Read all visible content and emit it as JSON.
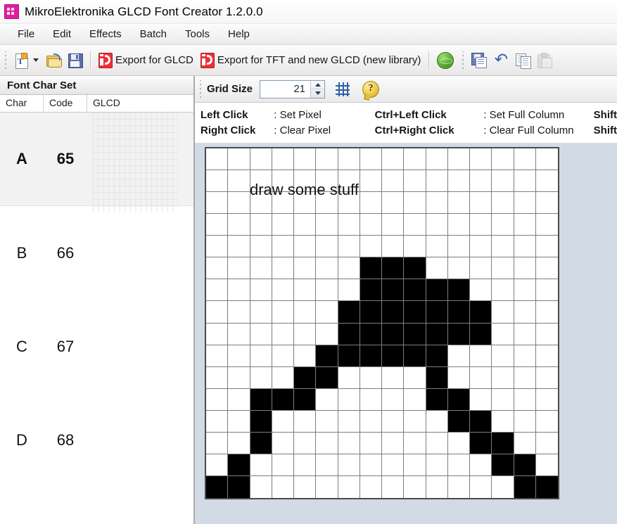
{
  "window": {
    "title": "MikroElektronika GLCD Font Creator 1.2.0.0",
    "app_icon": "app-icon"
  },
  "menubar": {
    "items": [
      {
        "label": "File"
      },
      {
        "label": "Edit"
      },
      {
        "label": "Effects"
      },
      {
        "label": "Batch"
      },
      {
        "label": "Tools"
      },
      {
        "label": "Help"
      }
    ]
  },
  "toolbar": {
    "new_font_label": "",
    "open_label": "",
    "save_label": "",
    "export_glcd_label": "Export for GLCD",
    "export_tft_label": "Export for TFT and new GLCD (new library)",
    "icons": {
      "new_font": "new-font-icon",
      "dropdown": "chevron-down-icon",
      "open": "open-folder-icon",
      "save": "save-icon",
      "export_glcd": "export-glcd-icon",
      "export_tft": "export-tft-icon",
      "web": "globe-icon",
      "save_as": "save-as-icon",
      "undo": "undo-icon",
      "copy": "copy-icon",
      "paste": "paste-icon"
    },
    "undo_glyph": "↶"
  },
  "grid_toolbar": {
    "grid_size_label": "Grid Size",
    "grid_size_value": "21",
    "grid_tool_icon": "grid-icon",
    "help_icon": "help-icon",
    "help_glyph": "?"
  },
  "left_panel": {
    "header": "Font Char Set",
    "columns": [
      "Char",
      "Code",
      "GLCD"
    ],
    "rows": [
      {
        "char": "A",
        "code": "65",
        "selected": true
      },
      {
        "char": "B",
        "code": "66",
        "selected": false
      },
      {
        "char": "C",
        "code": "67",
        "selected": false
      },
      {
        "char": "D",
        "code": "68",
        "selected": false
      }
    ]
  },
  "legend": {
    "line1": [
      {
        "key": "Left Click",
        "value": ": Set Pixel"
      },
      {
        "key": "Ctrl+Left Click",
        "value": ": Set Full Column"
      },
      {
        "key": "Shift",
        "value": ""
      }
    ],
    "line2": [
      {
        "key": "Right Click",
        "value": ": Clear Pixel"
      },
      {
        "key": "Ctrl+Right Click",
        "value": ": Clear Full Column"
      },
      {
        "key": "Shift",
        "value": ""
      }
    ]
  },
  "canvas": {
    "annotation": "draw some stuff",
    "grid_cols": 16,
    "grid_rows": 16,
    "on_color": "#000000",
    "off_color": "#ffffff",
    "line_color": "#7d7d7d",
    "filled_cells": [
      [
        5,
        7
      ],
      [
        5,
        8
      ],
      [
        5,
        9
      ],
      [
        6,
        7
      ],
      [
        6,
        8
      ],
      [
        6,
        9
      ],
      [
        6,
        10
      ],
      [
        6,
        11
      ],
      [
        7,
        6
      ],
      [
        7,
        7
      ],
      [
        7,
        8
      ],
      [
        7,
        9
      ],
      [
        7,
        10
      ],
      [
        7,
        11
      ],
      [
        7,
        12
      ],
      [
        8,
        6
      ],
      [
        8,
        7
      ],
      [
        8,
        8
      ],
      [
        8,
        9
      ],
      [
        8,
        10
      ],
      [
        8,
        11
      ],
      [
        8,
        12
      ],
      [
        9,
        5
      ],
      [
        9,
        6
      ],
      [
        9,
        7
      ],
      [
        9,
        8
      ],
      [
        9,
        9
      ],
      [
        9,
        10
      ],
      [
        10,
        4
      ],
      [
        10,
        5
      ],
      [
        10,
        10
      ],
      [
        11,
        2
      ],
      [
        11,
        3
      ],
      [
        11,
        4
      ],
      [
        11,
        10
      ],
      [
        11,
        11
      ],
      [
        12,
        2
      ],
      [
        12,
        11
      ],
      [
        12,
        12
      ],
      [
        13,
        2
      ],
      [
        13,
        12
      ],
      [
        13,
        13
      ],
      [
        14,
        1
      ],
      [
        14,
        13
      ],
      [
        14,
        14
      ],
      [
        15,
        0
      ],
      [
        15,
        1
      ],
      [
        15,
        14
      ],
      [
        15,
        15
      ]
    ]
  }
}
